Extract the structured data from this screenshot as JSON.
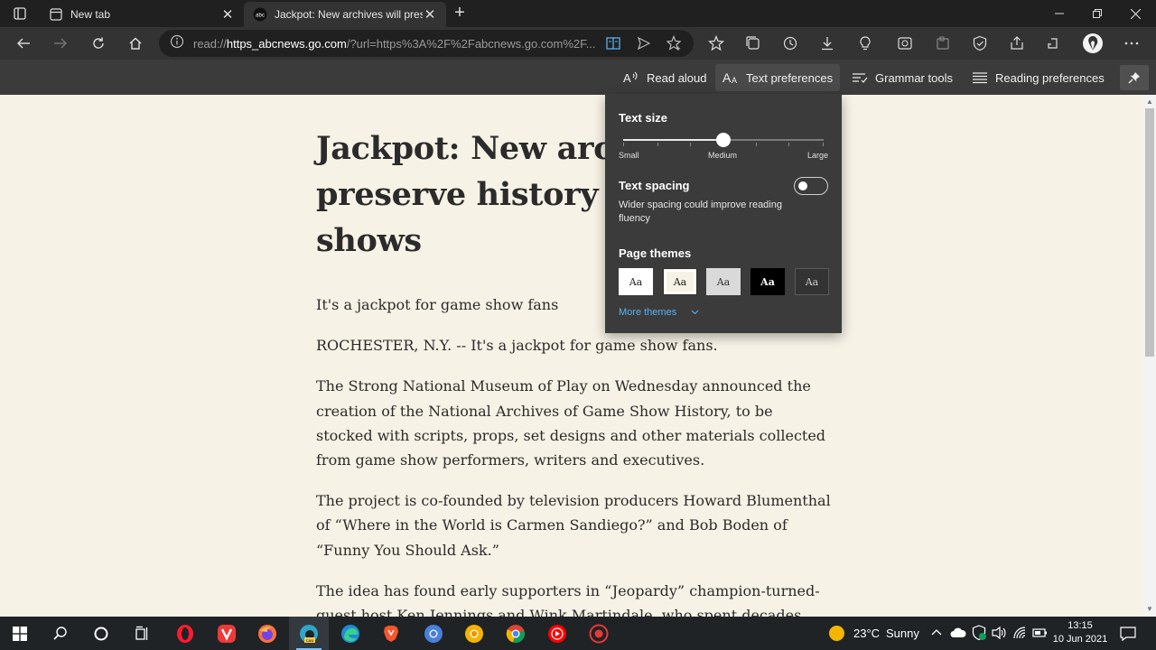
{
  "browser": {
    "tabs": [
      {
        "label": "New tab",
        "active": false
      },
      {
        "label": "Jackpot: New archives will preser",
        "active": true
      }
    ],
    "address": {
      "prefix": "read://",
      "host": "https_abcnews.go.com",
      "rest": "/?url=https%3A%2F%2Fabcnews.go.com%2F..."
    }
  },
  "reader_toolbar": {
    "read_aloud": "Read aloud",
    "text_preferences": "Text preferences",
    "grammar_tools": "Grammar tools",
    "reading_preferences": "Reading preferences"
  },
  "flyout": {
    "text_size": {
      "heading": "Text size",
      "small_label": "Small",
      "medium_label": "Medium",
      "large_label": "Large",
      "level": 0.5
    },
    "text_spacing": {
      "heading": "Text spacing",
      "description": "Wider spacing could improve reading fluency",
      "enabled": false
    },
    "page_themes": {
      "heading": "Page themes",
      "swatch_text": "Aa",
      "more_themes": "More themes",
      "swatches": [
        {
          "bg": "#ffffff",
          "fg": "#222222",
          "selected": false
        },
        {
          "bg": "#f7f2e6",
          "fg": "#222222",
          "selected": true
        },
        {
          "bg": "#d9d9d9",
          "fg": "#333333",
          "selected": false
        },
        {
          "bg": "#000000",
          "fg": "#ffffff",
          "selected": false
        },
        {
          "bg": "#333333",
          "fg": "#cccccc",
          "selected": false
        }
      ]
    }
  },
  "article": {
    "title": "Jackpot: New archives will preserve history of game shows",
    "title_visible_lines": [
      "Jackpot: New arch",
      "preserve history o",
      "shows"
    ],
    "paragraphs": [
      "It's a jackpot for game show fans",
      "ROCHESTER, N.Y. -- It's a jackpot for game show fans.",
      "The Strong National Museum of Play on Wednesday announced the creation of the National Archives of Game Show History, to be stocked with scripts, props, set designs and other materials collected from game show performers, writers and executives.",
      "The project is co-founded by television producers Howard Blumenthal of “Where in the World is Carmen Sandiego?” and Bob Boden of “Funny You Should Ask.”",
      "The idea has found early supporters in “Jeopardy” champion-turned-guest host Ken Jennings and Wink Martindale, who spent decades"
    ]
  },
  "taskbar": {
    "weather": {
      "temp": "23°C",
      "condition": "Sunny"
    },
    "time": "13:15",
    "date": "10 Jun 2021"
  }
}
